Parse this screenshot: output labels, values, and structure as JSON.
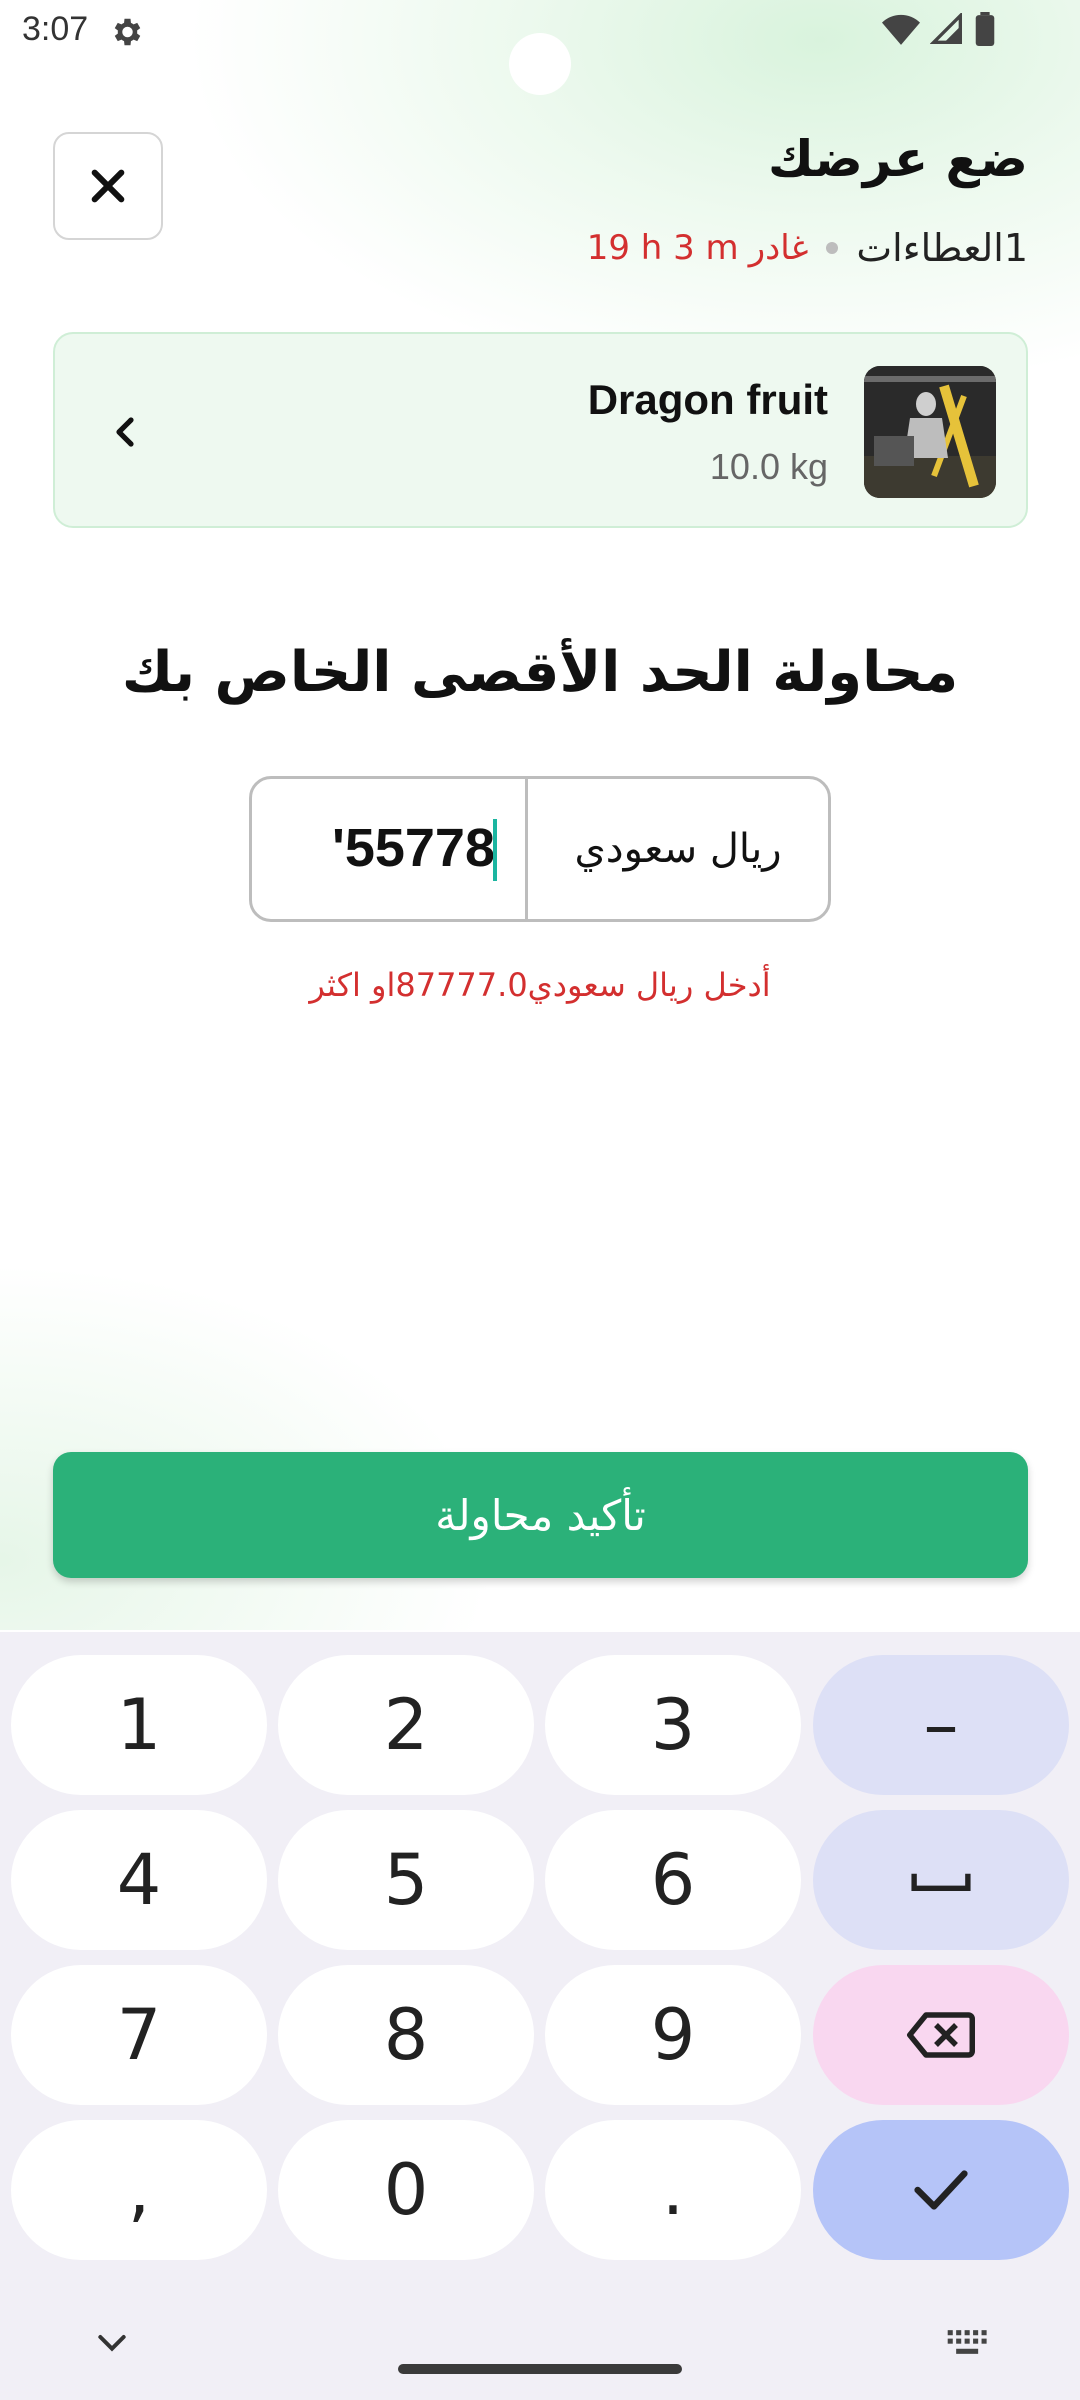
{
  "status_bar": {
    "time": "3:07"
  },
  "header": {
    "title": "ضع عرضك",
    "bids_label": "العطاءات",
    "bids_count": "1",
    "leaves_label": "غادر",
    "time_left": "19 h 3 m"
  },
  "product": {
    "name": "Dragon fruit",
    "weight": "10.0 kg"
  },
  "bid": {
    "heading": "محاولة الحد الأقصى الخاص بك",
    "amount": "'55778",
    "currency": "ريال سعودي",
    "error": "أدخل ريال سعودي87777.0او اكثر"
  },
  "confirm_button": {
    "label": "تأكيد محاولة"
  },
  "keyboard": {
    "keys": [
      "1",
      "2",
      "3",
      "4",
      "5",
      "6",
      "7",
      "8",
      "9",
      ",",
      "0",
      "."
    ],
    "fn_minus": "–"
  },
  "colors": {
    "accent_green": "#2bb179",
    "error_red": "#d32f2f",
    "caret_teal": "#1bb5a0"
  }
}
